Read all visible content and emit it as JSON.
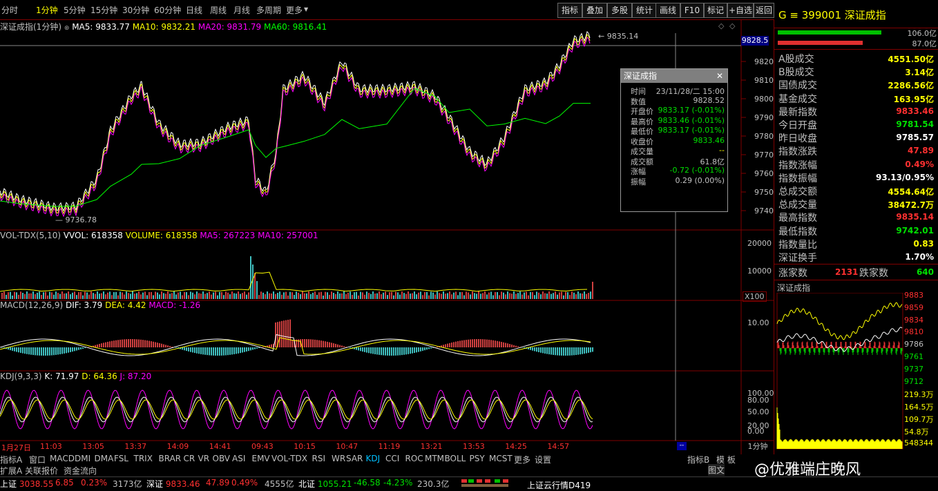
{
  "toolbar": {
    "periods": [
      "分时",
      "1分钟",
      "5分钟",
      "15分钟",
      "30分钟",
      "60分钟",
      "日线",
      "周线",
      "月线",
      "多周期",
      "更多"
    ],
    "buttons": [
      "指标",
      "叠加",
      "多股",
      "统计",
      "画线",
      "F10",
      "标记",
      "+自选",
      "返回"
    ]
  },
  "main": {
    "title": "深证成指(1分钟)",
    "ma_legend": [
      {
        "label": "MA5: 9833.77",
        "color": "#ffffff"
      },
      {
        "label": "MA10: 9832.21",
        "color": "#ffff00"
      },
      {
        "label": "MA20: 9831.79",
        "color": "#ff00ff"
      },
      {
        "label": "MA60: 9816.41",
        "color": "#00ff00"
      }
    ],
    "high_label": "9835.14",
    "low_label": "9736.78",
    "cursor_price": "9828.5",
    "price_ticks": [
      "9820",
      "9810",
      "9800",
      "9790",
      "9780",
      "9770",
      "9760",
      "9750",
      "9740"
    ]
  },
  "vol": {
    "legend": [
      {
        "label": "VOL-TDX(5,10)",
        "color": "#c0c0c0"
      },
      {
        "label": "VVOL: 618358",
        "color": "#ffffff"
      },
      {
        "label": "VOLUME: 618358",
        "color": "#ffff00"
      },
      {
        "label": "MA5: 267223",
        "color": "#ff00ff"
      },
      {
        "label": "MA10: 257001",
        "color": "#ff00ff"
      }
    ],
    "ticks": [
      "20000",
      "10000"
    ],
    "unit": "X100"
  },
  "macd": {
    "legend": [
      {
        "label": "MACD(12,26,9)",
        "color": "#c0c0c0"
      },
      {
        "label": "DIF: 3.79",
        "color": "#ffffff"
      },
      {
        "label": "DEA: 4.42",
        "color": "#ffff00"
      },
      {
        "label": "MACD: -1.26",
        "color": "#ff00ff"
      }
    ],
    "ticks": [
      "10.00"
    ]
  },
  "kdj": {
    "legend": [
      {
        "label": "KDJ(9,3,3)",
        "color": "#c0c0c0"
      },
      {
        "label": "K: 71.97",
        "color": "#ffffff"
      },
      {
        "label": "D: 64.36",
        "color": "#ffff00"
      },
      {
        "label": "J: 87.20",
        "color": "#ff00ff"
      }
    ],
    "ticks": [
      "100.00",
      "80.00",
      "50.00",
      "20.00",
      "0.00"
    ]
  },
  "time_axis": [
    "1月27日",
    "11:03",
    "13:05",
    "13:37",
    "14:09",
    "14:41",
    "09:43",
    "10:15",
    "10:47",
    "11:19",
    "13:21",
    "13:53",
    "14:25",
    "14:57"
  ],
  "period_label": "1分钟",
  "popup": {
    "title": "深证成指",
    "rows": [
      {
        "k": "时间",
        "v": "23/11/28/二 15:00",
        "c": "#c0c0c0"
      },
      {
        "k": "数值",
        "v": "9828.52",
        "c": "#c0c0c0"
      },
      {
        "k": "开盘价",
        "v": "9833.17 (-0.01%)",
        "c": "#00e000"
      },
      {
        "k": "最高价",
        "v": "9833.46 (-0.01%)",
        "c": "#00e000"
      },
      {
        "k": "最低价",
        "v": "9833.17 (-0.01%)",
        "c": "#00e000"
      },
      {
        "k": "收盘价",
        "v": "9833.46",
        "c": "#00e000"
      },
      {
        "k": "成交量",
        "v": "--",
        "c": "#ffff00"
      },
      {
        "k": "成交额",
        "v": "61.8亿",
        "c": "#c0c0c0"
      },
      {
        "k": "涨幅",
        "v": "-0.72 (-0.01%)",
        "c": "#00e000"
      },
      {
        "k": "振幅",
        "v": "0.29 (0.00%)",
        "c": "#c0c0c0"
      }
    ]
  },
  "right": {
    "code": "G ≡ 399001 深证成指",
    "bar_labels": [
      "106.0亿",
      "87.0亿"
    ],
    "stats": [
      {
        "k": "A股成交",
        "v": "4551.50亿",
        "c": "#ffff00"
      },
      {
        "k": "B股成交",
        "v": "3.14亿",
        "c": "#ffff00"
      },
      {
        "k": "国债成交",
        "v": "2286.56亿",
        "c": "#ffff00"
      },
      {
        "k": "基金成交",
        "v": "163.95亿",
        "c": "#ffff00"
      },
      {
        "k": "最新指数",
        "v": "9833.46",
        "c": "#ff3030"
      },
      {
        "k": "今日开盘",
        "v": "9781.54",
        "c": "#00e000"
      },
      {
        "k": "昨日收盘",
        "v": "9785.57",
        "c": "#ffffff"
      },
      {
        "k": "指数涨跌",
        "v": "47.89",
        "c": "#ff3030"
      },
      {
        "k": "指数涨幅",
        "v": "0.49%",
        "c": "#ff3030"
      },
      {
        "k": "指数振幅",
        "v": "93.13/0.95%",
        "c": "#ffffff"
      },
      {
        "k": "总成交额",
        "v": "4554.64亿",
        "c": "#ffff00"
      },
      {
        "k": "总成交量",
        "v": "38472.7万",
        "c": "#ffff00"
      },
      {
        "k": "最高指数",
        "v": "9835.14",
        "c": "#ff3030"
      },
      {
        "k": "最低指数",
        "v": "9742.01",
        "c": "#00e000"
      },
      {
        "k": "指数量比",
        "v": "0.83",
        "c": "#ffff00"
      },
      {
        "k": "深证换手",
        "v": "1.70%",
        "c": "#ffffff"
      }
    ],
    "rise_label": "涨家数",
    "rise": "2131",
    "fall_label": "跌家数",
    "fall": "640",
    "mini_title": "深证成指",
    "mini_ticks": [
      "9883",
      "9859",
      "9834",
      "9810",
      "9786",
      "9761",
      "9737",
      "9712",
      "219.3万",
      "164.5万",
      "109.7万",
      "54.8万",
      "548344"
    ]
  },
  "bottom_tabs": [
    "指标A",
    "窗口",
    "MACD",
    "DMI",
    "DMA",
    "FSL",
    "TRIX",
    "BRAR",
    "CR",
    "VR",
    "OBV",
    "ASI",
    "EMV",
    "VOL-TDX",
    "RSI",
    "WR",
    "SAR",
    "KDJ",
    "CCI",
    "ROC",
    "MTM",
    "BOLL",
    "PSY",
    "MCST",
    "更多",
    "设置"
  ],
  "right_tabs": [
    "指标B",
    "模 板"
  ],
  "sub_tabs": [
    "扩展A",
    "关联报价",
    "资金流向"
  ],
  "status": [
    {
      "k": "上证",
      "v": "3038.55",
      "c": "#ff3030"
    },
    {
      "k": "",
      "v": "6.85",
      "c": "#ff3030"
    },
    {
      "k": "",
      "v": "0.23%",
      "c": "#ff3030"
    },
    {
      "k": "",
      "v": "3173亿",
      "c": "#c0c0c0"
    },
    {
      "k": "深证",
      "v": "9833.46",
      "c": "#ff3030"
    },
    {
      "k": "",
      "v": "47.89",
      "c": "#ff3030"
    },
    {
      "k": "",
      "v": "0.49%",
      "c": "#ff3030"
    },
    {
      "k": "",
      "v": "4555亿",
      "c": "#c0c0c0"
    },
    {
      "k": "北证",
      "v": "1055.21",
      "c": "#00e000"
    },
    {
      "k": "",
      "v": "-46.58",
      "c": "#00e000"
    },
    {
      "k": "",
      "v": "-4.23%",
      "c": "#00e000"
    },
    {
      "k": "",
      "v": "230.3亿",
      "c": "#c0c0c0"
    }
  ],
  "status_right": "上证云行情D419",
  "watermark": "@优雅端庄晚风",
  "watermark_left": "图文"
}
